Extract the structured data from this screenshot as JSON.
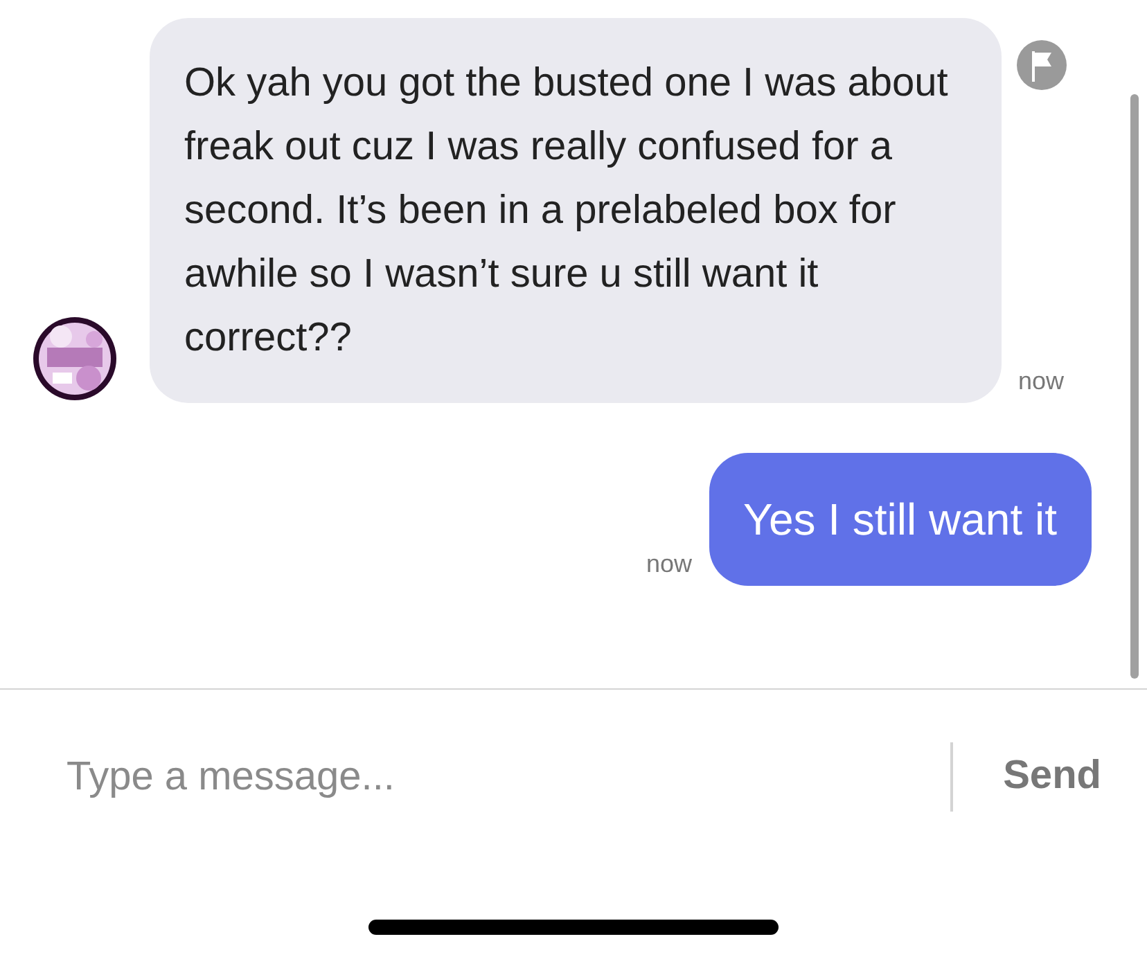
{
  "messages": [
    {
      "kind": "received",
      "text": "Ok yah you got the busted one I was about freak out cuz I was really confused for a second. It’s been in a prelabeled box for awhile so I wasn’t sure u still want it correct??",
      "time": "now"
    },
    {
      "kind": "sent",
      "text": "Yes I still want it",
      "time": "now"
    }
  ],
  "composer": {
    "placeholder": "Type a message...",
    "send": "Send"
  }
}
